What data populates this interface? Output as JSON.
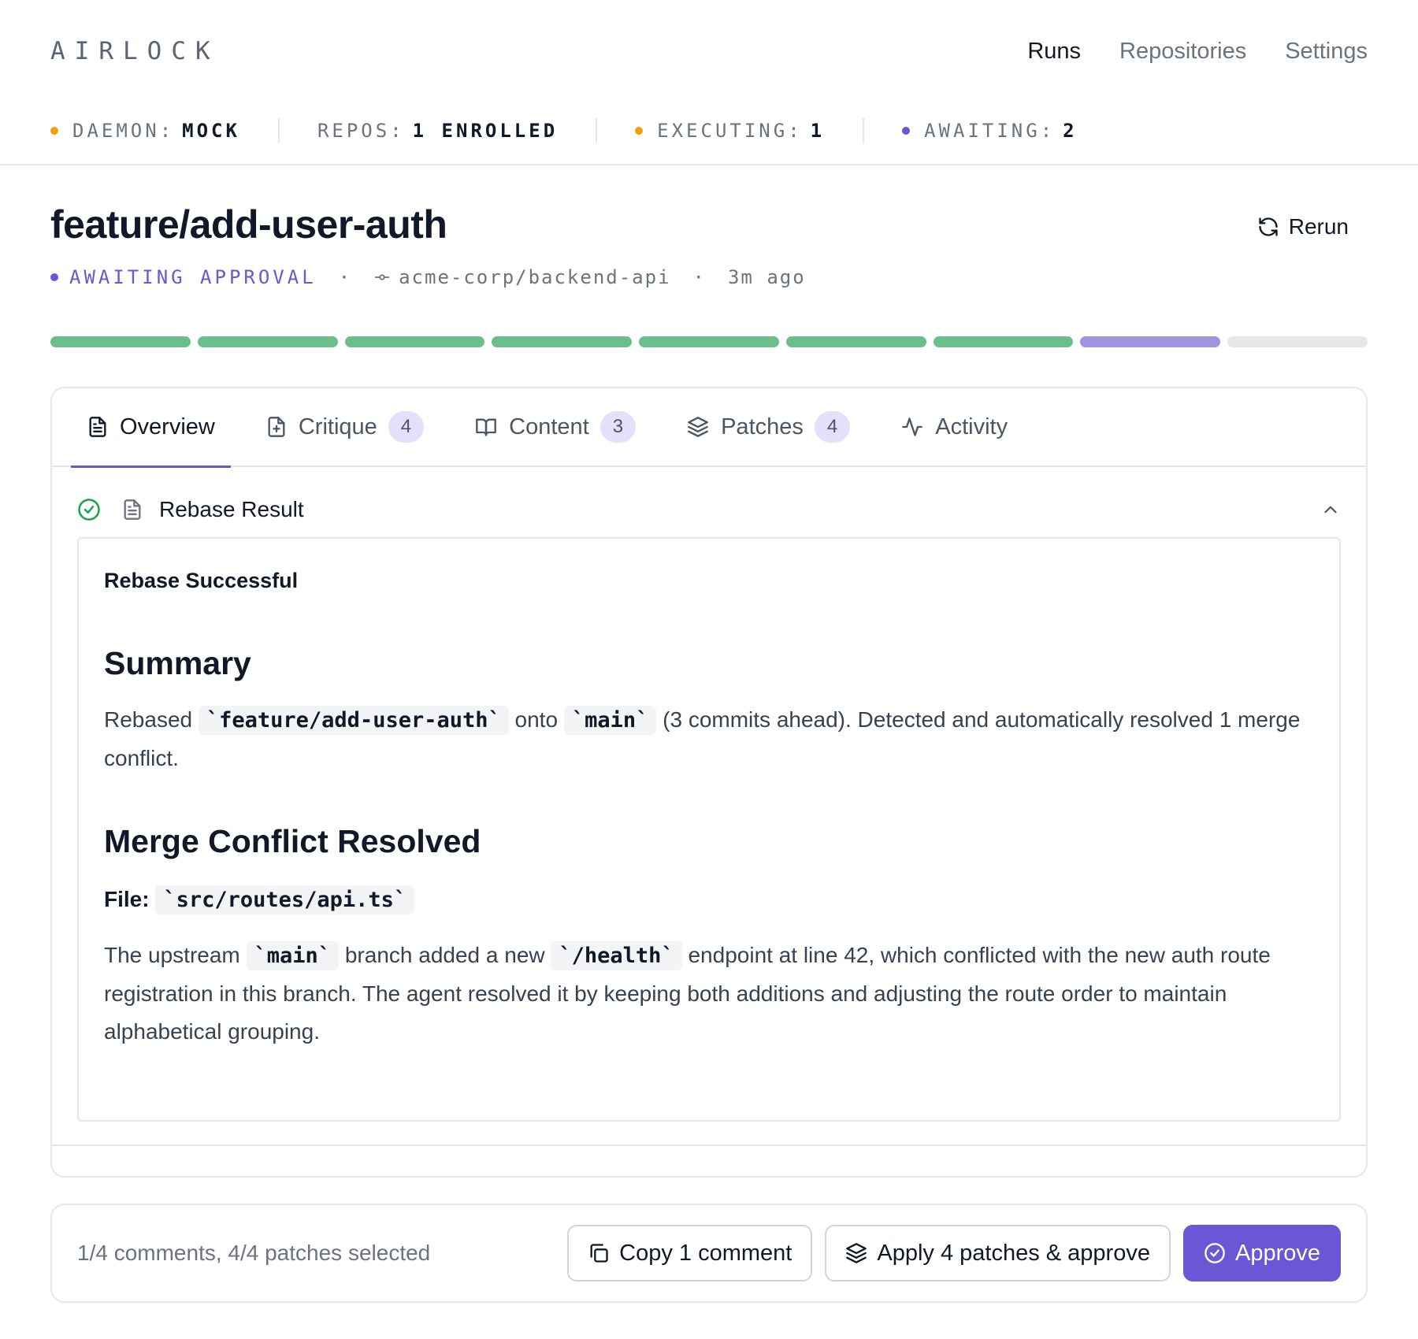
{
  "brand": "AIRLOCK",
  "nav": {
    "runs": "Runs",
    "repositories": "Repositories",
    "settings": "Settings"
  },
  "status": {
    "daemon_label": "DAEMON:",
    "daemon_value": "MOCK",
    "repos_label": "REPOS:",
    "repos_value": "1 ENROLLED",
    "executing_label": "EXECUTING:",
    "executing_value": "1",
    "awaiting_label": "AWAITING:",
    "awaiting_value": "2",
    "colors": {
      "daemon": "#f59e0b",
      "executing": "#f59e0b",
      "awaiting": "#6b56d6"
    }
  },
  "run": {
    "title": "feature/add-user-auth",
    "rerun_label": "Rerun",
    "state": "AWAITING APPROVAL",
    "separator": "·",
    "repo": "acme-corp/backend-api",
    "age": "3m ago"
  },
  "progress": {
    "steps_total": 9,
    "steps_completed": 7,
    "steps_current": 1,
    "colors": {
      "completed": "#6abf8a",
      "current": "#a294e2",
      "pending": "#e5e7eb"
    }
  },
  "tabs": [
    {
      "label": "Overview",
      "count": "",
      "icon": "file-text-icon"
    },
    {
      "label": "Critique",
      "count": "4",
      "icon": "file-plus-icon"
    },
    {
      "label": "Content",
      "count": "3",
      "icon": "book-open-icon"
    },
    {
      "label": "Patches",
      "count": "4",
      "icon": "layers-icon"
    },
    {
      "label": "Activity",
      "count": "",
      "icon": "activity-icon"
    }
  ],
  "section": {
    "title": "Rebase Result"
  },
  "result": {
    "heading": "Rebase Successful",
    "summary_title": "Summary",
    "summary_pre": "Rebased",
    "summary_code1": "`feature/add-user-auth`",
    "summary_mid": "onto",
    "summary_code2": "`main`",
    "summary_post": "(3 commits ahead). Detected and automatically resolved 1 merge conflict.",
    "conflict_title": "Merge Conflict Resolved",
    "file_label": "File:",
    "file_code": "`src/routes/api.ts`",
    "detail_pre": "The upstream",
    "detail_code1": "`main`",
    "detail_mid": "branch added a new",
    "detail_code2": "`/health`",
    "detail_post": "endpoint at line 42, which conflicted with the new auth route registration in this branch. The agent resolved it by keeping both additions and adjusting the route order to maintain alphabetical grouping."
  },
  "footer": {
    "selection": "1/4 comments, 4/4 patches selected",
    "copy_label": "Copy 1 comment",
    "apply_label": "Apply 4 patches & approve",
    "approve_label": "Approve",
    "accent": "#6b56d6"
  }
}
